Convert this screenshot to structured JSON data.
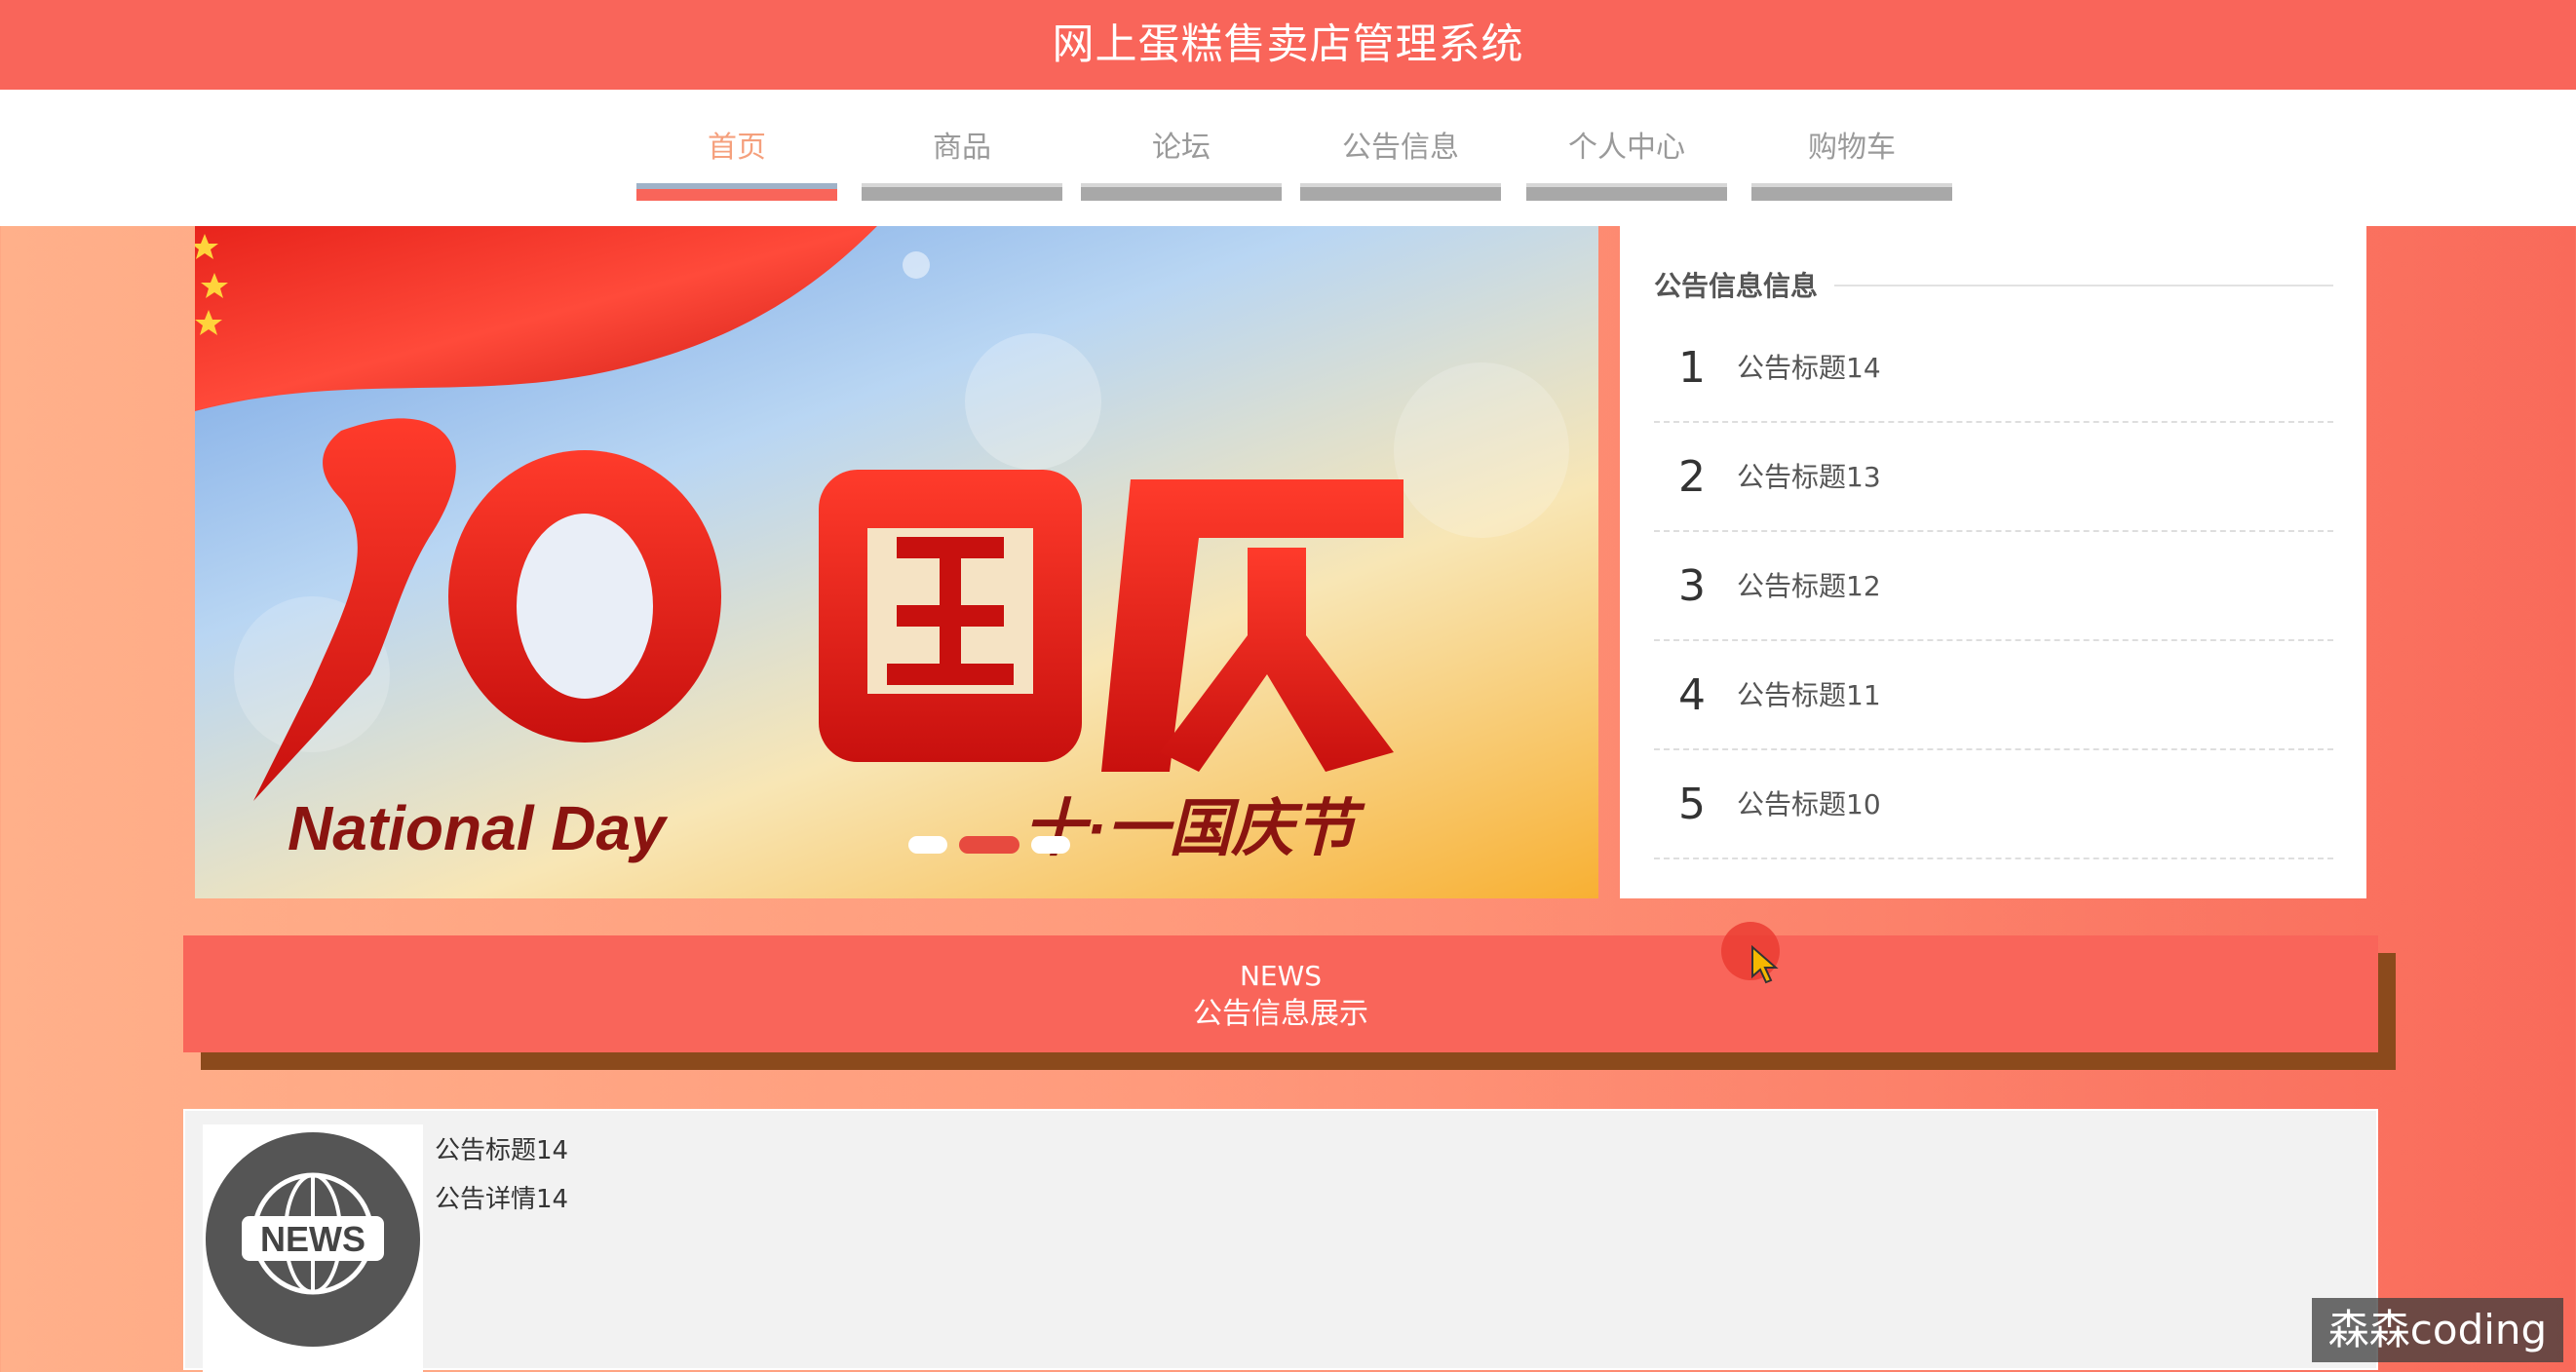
{
  "header": {
    "title": "网上蛋糕售卖店管理系统"
  },
  "nav": {
    "items": [
      {
        "label": "首页",
        "active": true
      },
      {
        "label": "商品",
        "active": false
      },
      {
        "label": "论坛",
        "active": false
      },
      {
        "label": "公告信息",
        "active": false
      },
      {
        "label": "个人中心",
        "active": false
      },
      {
        "label": "购物车",
        "active": false
      }
    ]
  },
  "banner": {
    "headline": "10·国庆",
    "english": "National Day",
    "subtitle": "十·一国庆节",
    "slide_count": 3,
    "active_slide": 2
  },
  "notice_panel": {
    "title": "公告信息信息",
    "items": [
      {
        "num": "1",
        "title": "公告标题14"
      },
      {
        "num": "2",
        "title": "公告标题13"
      },
      {
        "num": "3",
        "title": "公告标题12"
      },
      {
        "num": "4",
        "title": "公告标题11"
      },
      {
        "num": "5",
        "title": "公告标题10"
      }
    ]
  },
  "news_section": {
    "en_label": "NEWS",
    "cn_label": "公告信息展示",
    "items": [
      {
        "thumb_text": "NEWS",
        "title": "公告标题14",
        "detail": "公告详情14"
      }
    ]
  },
  "watermark": "森森coding",
  "colors": {
    "primary": "#f9655a",
    "nav_active_text": "#f5a07d",
    "shadow": "#8b4a1c"
  }
}
